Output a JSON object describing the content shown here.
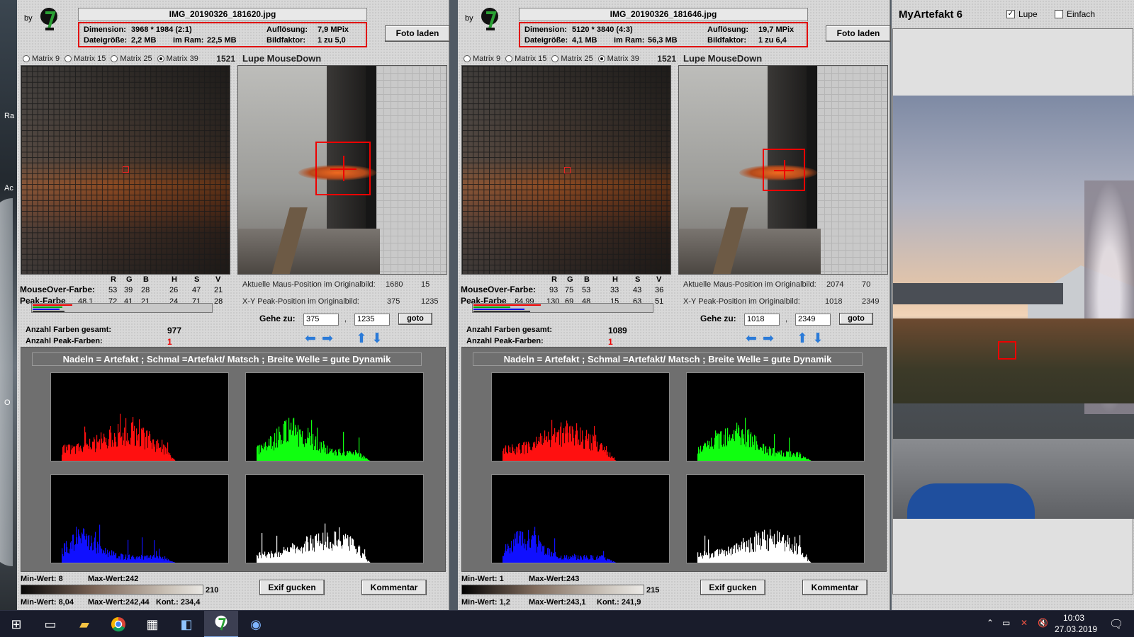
{
  "left": {
    "by": "by",
    "filename": "IMG_20190326_181620.jpg",
    "info": {
      "dim_label": "Dimension:",
      "dim_value": "3968 * 1984 (2:1)",
      "res_label": "Auflösung:",
      "res_value": "7,9 MPix",
      "size_label": "Dateigröße:",
      "size_value": "2,2 MB",
      "ram_label": "im Ram:",
      "ram_value": "22,5 MB",
      "factor_label": "Bildfaktor:",
      "factor_value": "1 zu 5,0"
    },
    "load_button": "Foto laden",
    "matrix": [
      "Matrix 9",
      "Matrix 15",
      "Matrix 25",
      "Matrix 39"
    ],
    "matrix_selected": 3,
    "matrix_count": "1521",
    "lupe_title": "Lupe MouseDown",
    "cols": [
      "R",
      "G",
      "B",
      "H",
      "S",
      "V"
    ],
    "mouse_label": "MouseOver-Farbe:",
    "mouse_vals": [
      "53",
      "39",
      "28",
      "26",
      "47",
      "21"
    ],
    "peak_label": "Peak-Farbe",
    "peak_factor": "48,1",
    "peak_vals": [
      "72",
      "41",
      "21",
      "24",
      "71",
      "28"
    ],
    "pos_label": "Aktuelle Maus-Position  im Originalbild:",
    "pos_x": "1680",
    "pos_y": "15",
    "peak_pos_label": "X-Y Peak-Position  im Originalbild:",
    "peak_x": "375",
    "peak_y": "1235",
    "goto_label": "Gehe zu:",
    "goto_x": "375",
    "goto_y": "1235",
    "goto_btn": "goto",
    "comma": ",",
    "total_label": "Anzahl Farben gesamt:",
    "total_value": "977",
    "peak_count_label": "Anzahl Peak-Farben:",
    "peak_count_value": "1",
    "histo_caption": "Nadeln = Artefakt ; Schmal =Artefakt/ Matsch  ;  Breite Welle = gute Dynamik",
    "min_label": "Min-Wert: 8",
    "max_label": "Max-Wert:242",
    "range": "210",
    "min2": "Min-Wert: 8,04",
    "max2": "Max-Wert:242,44",
    "kont": "Kont.: 234,4",
    "exif_btn": "Exif gucken",
    "comment_btn": "Kommentar"
  },
  "right": {
    "by": "by",
    "filename": "IMG_20190326_181646.jpg",
    "info": {
      "dim_label": "Dimension:",
      "dim_value": "5120 * 3840 (4:3)",
      "res_label": "Auflösung:",
      "res_value": "19,7 MPix",
      "size_label": "Dateigröße:",
      "size_value": "4,1 MB",
      "ram_label": "im Ram:",
      "ram_value": "56,3 MB",
      "factor_label": "Bildfaktor:",
      "factor_value": "1 zu 6,4"
    },
    "load_button": "Foto laden",
    "matrix": [
      "Matrix 9",
      "Matrix 15",
      "Matrix 25",
      "Matrix 39"
    ],
    "matrix_selected": 3,
    "matrix_count": "1521",
    "lupe_title": "Lupe MouseDown",
    "cols": [
      "R",
      "G",
      "B",
      "H",
      "S",
      "V"
    ],
    "mouse_label": "MouseOver-Farbe:",
    "mouse_vals": [
      "93",
      "75",
      "53",
      "33",
      "43",
      "36"
    ],
    "peak_label": "Peak-Farbe",
    "peak_factor": "84,99",
    "peak_vals": [
      "130",
      "69",
      "48",
      "15",
      "63",
      "51"
    ],
    "pos_label": "Aktuelle Maus-Position  im Originalbild:",
    "pos_x": "2074",
    "pos_y": "70",
    "peak_pos_label": "X-Y Peak-Position  im Originalbild:",
    "peak_x": "1018",
    "peak_y": "2349",
    "goto_label": "Gehe zu:",
    "goto_x": "1018",
    "goto_y": "2349",
    "goto_btn": "goto",
    "comma": ",",
    "total_label": "Anzahl Farben gesamt:",
    "total_value": "1089",
    "peak_count_label": "Anzahl Peak-Farben:",
    "peak_count_value": "1",
    "histo_caption": "Nadeln = Artefakt ; Schmal =Artefakt/ Matsch  ;  Breite Welle = gute Dynamik",
    "min_label": "Min-Wert: 1",
    "max_label": "Max-Wert:243",
    "range": "215",
    "min2": "Min-Wert: 1,2",
    "max2": "Max-Wert:243,1",
    "kont": "Kont.: 241,9",
    "exif_btn": "Exif gucken",
    "comment_btn": "Kommentar"
  },
  "app": {
    "title": "MyArtefakt 6",
    "lupe_cb": "Lupe",
    "lupe_checked": true,
    "einfach_cb": "Einfach",
    "einfach_checked": false
  },
  "desktop_labels": [
    "Ra",
    "Ac",
    "O"
  ],
  "taskbar": {
    "time": "10:03",
    "date": "27.03.2019",
    "icons": [
      "windows-start-icon",
      "task-view-icon",
      "file-explorer-icon",
      "chrome-icon",
      "calculator-icon",
      "notepad-icon",
      "myartefakt-icon",
      "media-player-icon"
    ]
  },
  "colors": {
    "red": "#e00000",
    "histo_red": "#ff1010",
    "histo_green": "#10ff10",
    "histo_blue": "#1010ff",
    "histo_white": "#ffffff",
    "arrow_blue": "#2a7ad8"
  }
}
